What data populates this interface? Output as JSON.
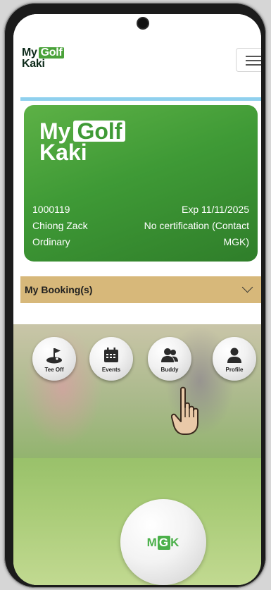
{
  "header": {
    "logo": {
      "my": "My",
      "golf": "Golf",
      "kaki": "Kaki"
    }
  },
  "card": {
    "logo": {
      "my": "My",
      "golf": "Golf",
      "kaki": "Kaki"
    },
    "member_id": "1000119",
    "expiry": "Exp 11/11/2025",
    "name": "Chiong Zack",
    "certification_line1": "No certification (Contact",
    "membership_type": "Ordinary",
    "certification_line2": "MGK)"
  },
  "booking": {
    "title": "My Booking(s)"
  },
  "quick_actions": [
    {
      "label": "Tee Off",
      "icon": "golf-flag-icon"
    },
    {
      "label": "Events",
      "icon": "calendar-icon"
    },
    {
      "label": "Buddy",
      "icon": "people-icon"
    },
    {
      "label": "Profile",
      "icon": "person-icon"
    }
  ],
  "footer_ball": {
    "text_m": "M",
    "text_g": "G",
    "text_k": "K"
  },
  "colors": {
    "brand_green": "#3f9a36",
    "booking_bar": "#d7b87a",
    "accent_line": "#8fd0ee"
  }
}
